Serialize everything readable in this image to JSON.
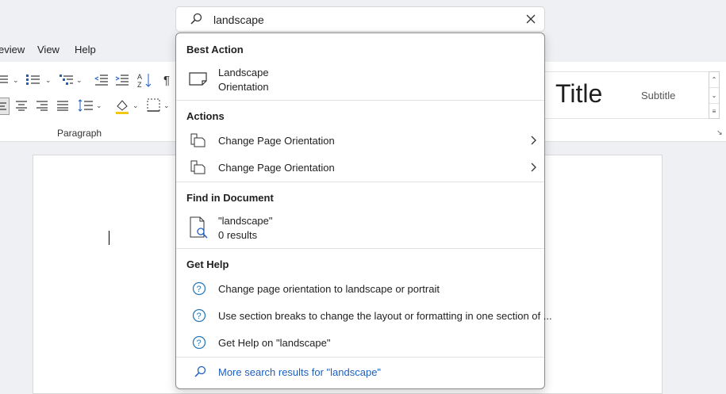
{
  "menu": {
    "items": [
      "eview",
      "View",
      "Help"
    ]
  },
  "ribbon": {
    "paragraph_label": "Paragraph",
    "style_title": "Title",
    "style_subtitle": "Subtitle"
  },
  "search": {
    "query": "landscape"
  },
  "results": {
    "best_action": {
      "header": "Best Action",
      "item": {
        "line1": "Landscape",
        "line2": "Orientation",
        "icon": "page-landscape-icon"
      }
    },
    "actions": {
      "header": "Actions",
      "items": [
        {
          "label": "Change Page Orientation",
          "icon": "page-orientation-icon"
        },
        {
          "label": "Change Page Orientation",
          "icon": "page-orientation-icon"
        }
      ]
    },
    "find": {
      "header": "Find in Document",
      "item": {
        "line1": "\"landscape\"",
        "line2": "0 results",
        "icon": "document-search-icon"
      }
    },
    "help": {
      "header": "Get Help",
      "items": [
        {
          "label": "Change page orientation to landscape or portrait",
          "icon": "help-icon"
        },
        {
          "label": "Use section breaks to change the layout or formatting in one section of ...",
          "icon": "help-icon"
        },
        {
          "label": "Get Help on \"landscape\"",
          "icon": "help-icon"
        }
      ]
    },
    "more": {
      "label": "More search results for \"landscape\"",
      "icon": "search-icon"
    }
  },
  "colors": {
    "accent": "#1d5fbf",
    "help_icon": "#2a7ab8",
    "background": "#eef0f3"
  }
}
